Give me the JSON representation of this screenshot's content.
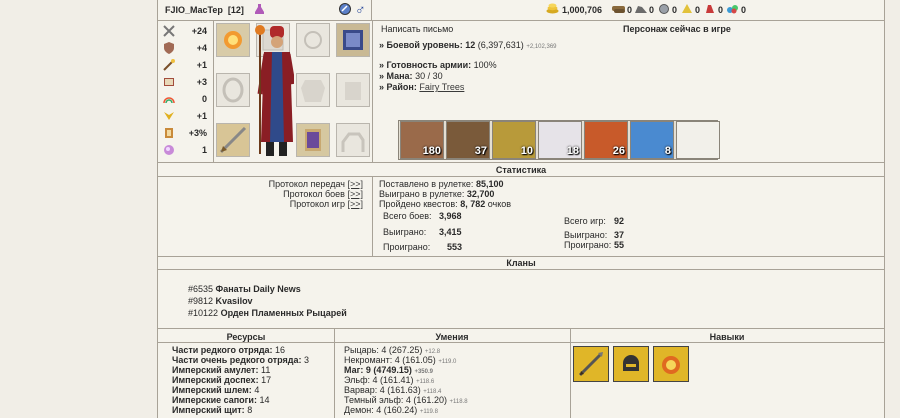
{
  "header": {
    "nick": "FJIO_MacTep",
    "level_badge": "[12]",
    "gold": "1,000,706",
    "resources": [
      {
        "icon": "wood-icon",
        "value": "0"
      },
      {
        "icon": "ore-icon",
        "value": "0"
      },
      {
        "icon": "mercury-icon",
        "value": "0"
      },
      {
        "icon": "sulfur-icon",
        "value": "0"
      },
      {
        "icon": "crystal-icon",
        "value": "0"
      },
      {
        "icon": "gems-icon",
        "value": "0"
      }
    ]
  },
  "stats": [
    {
      "icon": "attack-icon",
      "value": "+24"
    },
    {
      "icon": "defense-icon",
      "value": "+4"
    },
    {
      "icon": "spellpower-icon",
      "value": "+1"
    },
    {
      "icon": "knowledge-icon",
      "value": "+3"
    },
    {
      "icon": "luck-icon",
      "value": "0"
    },
    {
      "icon": "morale-icon",
      "value": "+1"
    },
    {
      "icon": "initiative-icon",
      "value": "+3%"
    },
    {
      "icon": "mana-icon",
      "value": "1"
    }
  ],
  "info": {
    "write_letter": "Написать письмо",
    "status": "Персонаж сейчас в игре",
    "combat_level_label": "» Боевой уровень:",
    "combat_level": "12",
    "combat_exp": "(6,397,631)",
    "combat_exp_small": "+2,102,369",
    "army_ready_label": "» Готовность армии:",
    "army_ready": "100%",
    "mana_label": "» Мана:",
    "mana": "30 / 30",
    "district_label": "» Район:",
    "district": "Fairy Trees"
  },
  "army": [
    "180",
    "37",
    "10",
    "18",
    "26",
    "8"
  ],
  "statistics": {
    "title": "Статистика",
    "protocols": [
      {
        "label": "Протокол передач",
        "link": "[>>]"
      },
      {
        "label": "Протокол боев",
        "link": "[>>]"
      },
      {
        "label": "Протокол игр",
        "link": "[>>]"
      }
    ],
    "roulette_bet_label": "Поставлено в рулетке:",
    "roulette_bet": "85,100",
    "roulette_won_label": "Выиграно в рулетке:",
    "roulette_won": "32,700",
    "quests_label": "Пройдено квестов:",
    "quests_value": "8, 782",
    "quests_suffix": "очков",
    "battles": [
      {
        "label": "Всего боев:",
        "value": "3,968"
      },
      {
        "label": "Выиграно:",
        "value": "3,415"
      },
      {
        "label": "Проиграно:",
        "value": "553"
      }
    ],
    "games": [
      {
        "label": "Всего игр:",
        "value": "92"
      },
      {
        "label": "Выиграно:",
        "value": "37"
      },
      {
        "label": "Проиграно:",
        "value": "55"
      }
    ]
  },
  "clans": {
    "title": "Кланы",
    "list": [
      {
        "id": "#6535",
        "name": "Фанаты Daily News"
      },
      {
        "id": "#9812",
        "name": "Kvasilov"
      },
      {
        "id": "#10122",
        "name": "Орден Пламенных Рыцарей"
      }
    ]
  },
  "resources_section": {
    "title": "Ресурсы",
    "items": [
      {
        "name": "Части редкого отряда:",
        "value": "16"
      },
      {
        "name": "Части очень редкого отряда:",
        "value": "3"
      },
      {
        "name": "Имперский амулет:",
        "value": "11"
      },
      {
        "name": "Имперский доспех:",
        "value": "17"
      },
      {
        "name": "Имперский шлем:",
        "value": "4"
      },
      {
        "name": "Имперские сапоги:",
        "value": "14"
      },
      {
        "name": "Имперский щит:",
        "value": "8"
      }
    ]
  },
  "skills_section": {
    "title": "Умения",
    "items": [
      {
        "name": "Рыцарь:",
        "value": "4 (267.25)",
        "delta": "+12.8",
        "bold": false
      },
      {
        "name": "Некромант:",
        "value": "4 (161.05)",
        "delta": "+119.0",
        "bold": false
      },
      {
        "name": "Маг:",
        "value": "9 (4749.15)",
        "delta": "+350.9",
        "bold": true
      },
      {
        "name": "Эльф:",
        "value": "4 (161.41)",
        "delta": "+118.6",
        "bold": false
      },
      {
        "name": "Варвар:",
        "value": "4 (161.63)",
        "delta": "+118.4",
        "bold": false
      },
      {
        "name": "Темный эльф:",
        "value": "4 (161.20)",
        "delta": "+118.8",
        "bold": false
      },
      {
        "name": "Демон:",
        "value": "4 (160.24)",
        "delta": "+119.8",
        "bold": false
      }
    ]
  },
  "talents_section": {
    "title": "Навыки"
  }
}
